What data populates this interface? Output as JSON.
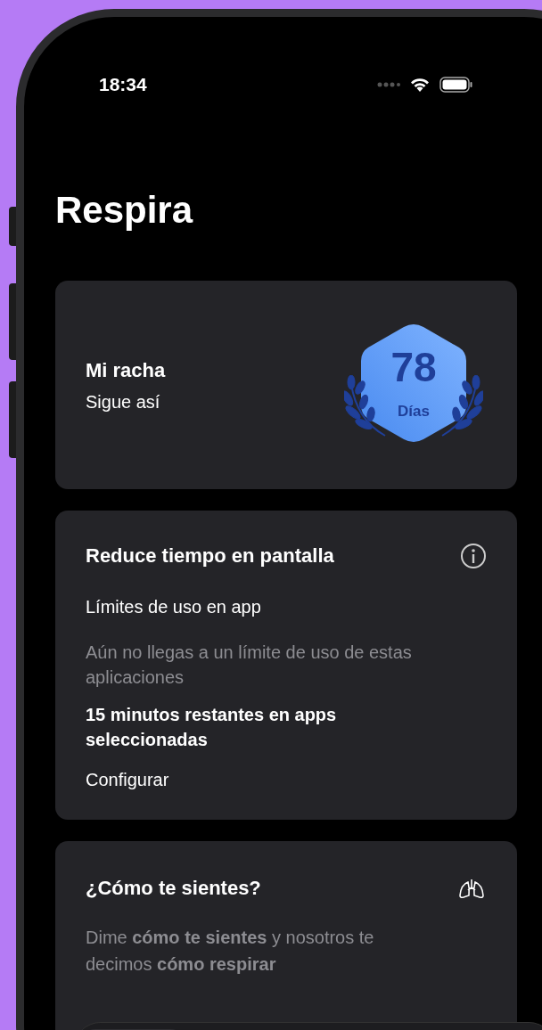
{
  "status_bar": {
    "time": "18:34"
  },
  "title": "Respira",
  "streak_card": {
    "title": "Mi racha",
    "subtitle": "Sigue así",
    "badge": {
      "value": "78",
      "unit": "Días"
    }
  },
  "screen_time_card": {
    "title": "Reduce tiempo en pantalla",
    "subtitle": "Límites de uso en app",
    "note": "Aún no llegas a un límite de uso de estas aplicaciones",
    "remaining": "15 minutos restantes en apps seleccionadas",
    "action": "Configurar"
  },
  "feeling_card": {
    "title": "¿Cómo te sientes?",
    "description": "Dime **cómo te sientes** y nosotros te decimos **cómo respirar**"
  }
}
